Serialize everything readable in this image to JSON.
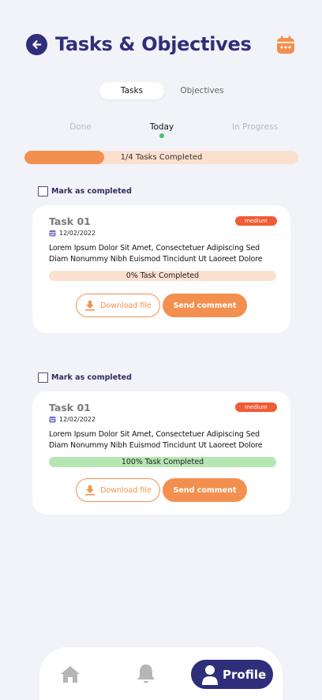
{
  "header": {
    "title": "Tasks & Objectives",
    "back_icon": "arrow-left-icon",
    "calendar_icon": "calendar-icon"
  },
  "segments": {
    "tasks": "Tasks",
    "objectives": "Objectives",
    "selected": "Tasks"
  },
  "status_tabs": {
    "done": "Done",
    "today": "Today",
    "in_progress": "In Progress",
    "selected": "Today"
  },
  "overall_progress": {
    "label": "1/4 Tasks Completed",
    "fraction": 0.29
  },
  "tasks": [
    {
      "mark_label": "Mark as completed",
      "checked": false,
      "title": "Task 01",
      "priority": "medium",
      "date": "12/02/2022",
      "description": "Lorem Ipsum Dolor Sit Amet, Consectetuer Adipiscing Sed Diam Nonummy Nibh Euismod Tincidunt Ut Laoreet Dolore",
      "progress_label": "0% Task Completed",
      "progress": 0,
      "download_label": "Download file",
      "send_label": "Send comment"
    },
    {
      "mark_label": "Mark as completed",
      "checked": false,
      "title": "Task 01",
      "priority": "medium",
      "date": "12/02/2022",
      "description": "Lorem Ipsum Dolor Sit Amet, Consectetuer Adipiscing Sed Diam Nonummy Nibh Euismod Tincidunt Ut Laoreet Dolore",
      "progress_label": "100% Task Completed",
      "progress": 100,
      "download_label": "Download file",
      "send_label": "Send comment"
    }
  ],
  "bottom_nav": {
    "home_icon": "home-icon",
    "bell_icon": "bell-icon",
    "profile_label": "Profile",
    "profile_icon": "user-icon",
    "selected": "Profile"
  },
  "colors": {
    "primary": "#2f2e7a",
    "accent": "#f3904f",
    "accent_light": "#fce0cf",
    "success_light": "#b5e6b4",
    "priority_medium": "#ef5c36",
    "today_dot": "#3dc36b"
  }
}
